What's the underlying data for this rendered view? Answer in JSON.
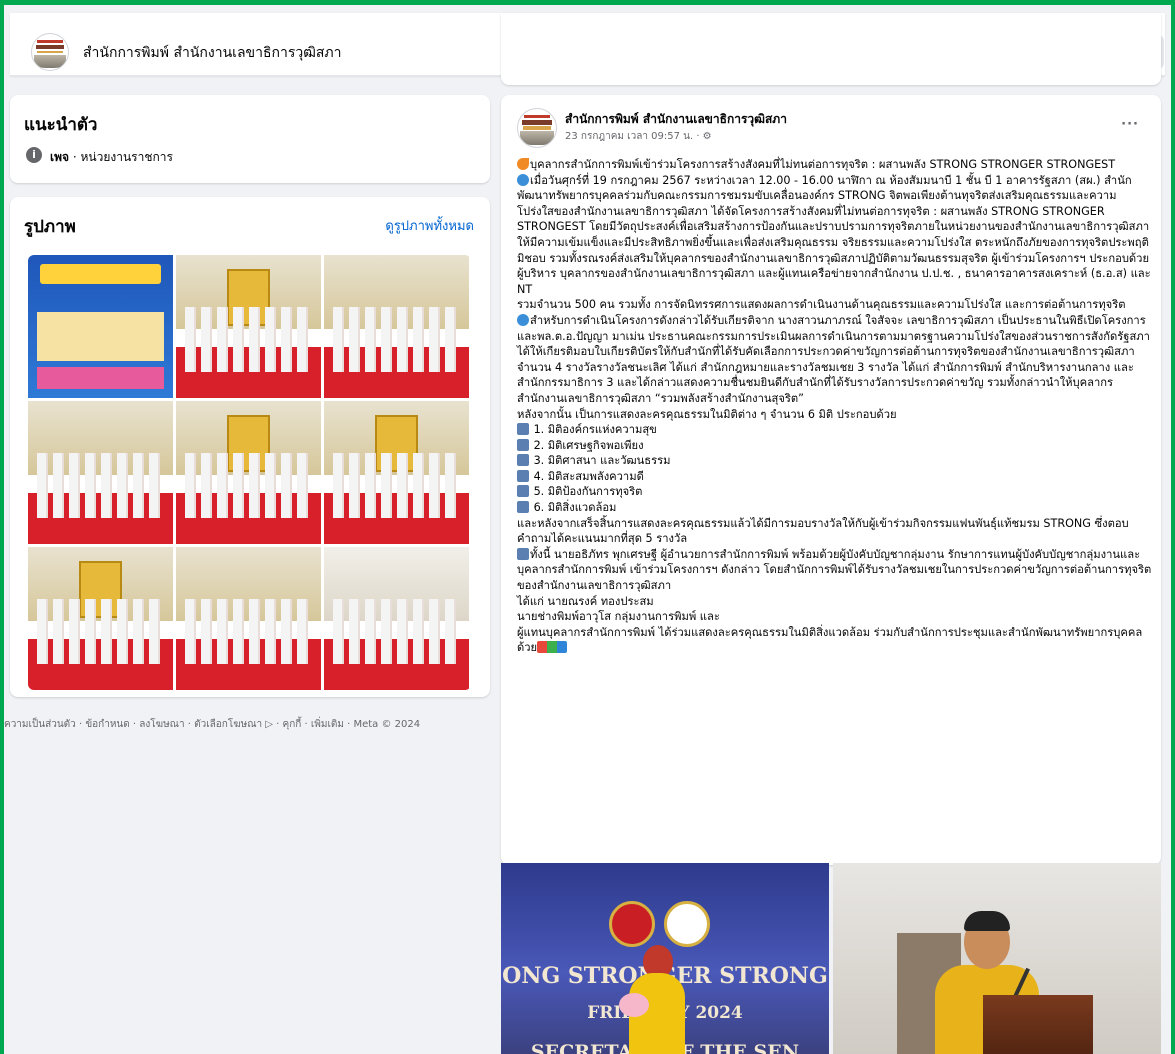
{
  "header": {
    "page_name": "สำนักการพิมพ์ สำนักงานเลขาธิการวุฒิสภา",
    "more_label": "···"
  },
  "intro": {
    "title": "แนะนำตัว",
    "type_bold": "เพจ",
    "type_rest": " · หน่วยงานราชการ"
  },
  "photos": {
    "title": "รูปภาพ",
    "see_all": "ดูรูปภาพทั้งหมด"
  },
  "footer": {
    "text": "ความเป็นส่วนตัว · ข้อกำหนด · ลงโฆษณา · ตัวเลือกโฆษณา ▷ · คุกกี้ · เพิ่มเติม · Meta © 2024"
  },
  "post": {
    "author": "สำนักการพิมพ์ สำนักงานเลขาธิการวุฒิสภา",
    "meta": "23 กรกฎาคม เวลา 09:57 น. · ⚙",
    "more_label": "···",
    "lines": [
      "บุคลากรสำนักการพิมพ์เข้าร่วมโครงการสร้างสังคมที่ไม่ทนต่อการทุจริต : ผสานพลัง STRONG STRONGER STRONGEST",
      "เมื่อวันศุกร์ที่ 19 กรกฎาคม 2567 ระหว่างเวลา 12.00 - 16.00 นาฬิกา ณ ห้องสัมมนาบี 1 ชั้น บี 1 อาคารรัฐสภา (สผ.) สำนักพัฒนาทรัพยากรบุคคลร่วมกับคณะกรรมการชมรมขับเคลื่อนองค์กร STRONG จิตพอเพียงต้านทุจริตส่งเสริมคุณธรรมและความโปร่งใสของสำนักงานเลขาธิการวุฒิสภา ได้จัดโครงการสร้างสังคมที่ไม่ทนต่อการทุจริต : ผสานพลัง STRONG STRONGER STRONGEST โดยมีวัตถุประสงค์เพื่อเสริมสร้างการป้องกันและปราบปรามการทุจริตภายในหน่วยงานของสำนักงานเลขาธิการวุฒิสภาให้มีความเข้มแข็งและมีประสิทธิภาพยิ่งขึ้นและเพื่อส่งเสริมคุณธรรม จริยธรรมและความโปร่งใส ตระหนักถึงภัยของการทุจริตประพฤติมิชอบ รวมทั้งรณรงค์ส่งเสริมให้บุคลากรของสำนักงานเลขาธิการวุฒิสภาปฏิบัติตามวัฒนธรรมสุจริต ผู้เข้าร่วมโครงการฯ ประกอบด้วย ผู้บริหาร บุคลากรของสำนักงานเลขาธิการวุฒิสภา และผู้แทนเครือข่ายจากสำนักงาน ป.ป.ช. , ธนาคารอาคารสงเคราะห์ (ธ.อ.ส) และ NT",
      "รวมจำนวน 500 คน รวมทั้ง การจัดนิทรรศการแสดงผลการดำเนินงานด้านคุณธรรมและความโปร่งใส และการต่อต้านการทุจริต",
      "สำหรับการดำเนินโครงการดังกล่าวได้รับเกียรติจาก นางสาวนภาภรณ์  ใจสัจจะ เลขาธิการวุฒิสภา เป็นประธานในพิธีเปิดโครงการ และพล.ต.อ.ปัญญา  มาเม่น ประธานคณะกรรมการประเมินผลการดำเนินการตามมาตรฐานความโปร่งใสของส่วนราชการสังกัดรัฐสภา ได้ให้เกียรติมอบใบเกียรติบัตรให้กับสำนักที่ได้รับคัดเลือกการประกวดค่าขวัญการต่อต้านการทุจริตของสำนักงานเลขาธิการวุฒิสภา จำนวน 4 รางวัลรางวัลชนะเลิศ ได้แก่ สำนักกฎหมายและรางวัลชมเชย 3 รางวัล ได้แก่  สำนักการพิมพ์ สำนักบริหารงานกลาง และสำนักกรรมาธิการ 3 และได้กล่าวแสดงความชื่นชมยินดีกับสำนักที่ได้รับรางวัลการประกวดค่าขวัญ รวมทั้งกล่าวนำให้บุคลากรสำนักงานเลขาธิการวุฒิสภา “รวมพลังสร้างสำนักงานสุจริต”",
      "หลังจากนั้น เป็นการแสดงละครคุณธรรมในมิติต่าง ๆ จำนวน 6 มิติ ประกอบด้วย"
    ],
    "list": [
      "1. มิติองค์กรแห่งความสุข",
      "2. มิติเศรษฐกิจพอเพียง",
      "3. มิติศาสนา และวัฒนธรรม",
      "4. มิติสะสมพลังความดี",
      "5. มิติป้องกันการทุจริต",
      "6. มิติสิ่งแวดล้อม"
    ],
    "after_list": [
      "และหลังจากเสร็จสิ้นการแสดงละครคุณธรรมแล้วได้มีการมอบรางวัลให้กับผู้เข้าร่วมกิจกรรมแฟนพันธุ์แท้ชมรม STRONG ซึ่งตอบคำถามได้คะแนนมากที่สุด 5 รางวัล",
      "ทั้งนี้ นายอธิภัทร พุกเศรษฐี ผู้อำนวยการสำนักการพิมพ์ พร้อมด้วยผู้บังคับบัญชากลุ่มงาน รักษาการแทนผู้บังคับบัญชากลุ่มงานและบุคลากรสำนักการพิมพ์ เข้าร่วมโครงการฯ ดังกล่าว โดยสำนักการพิมพ์ได้รับรางวัลชมเชยในการประกวดค่าขวัญการต่อต้านการทุจริตของสำนักงานเลขาธิการวุฒิสภา",
      "ได้แก่ นายณรงค์ ทองประสม",
      "นายช่างพิมพ์อาวุโส กลุ่มงานการพิมพ์ และ",
      "ผู้แทนบุคลากรสำนักการพิมพ์ ได้ร่วมแสดงละครคุณธรรมในมิติสิ่งแวดล้อม ร่วมกับสำนักการประชุมและสำนักพัฒนาทรัพยากรบุคคลด้วย"
    ]
  },
  "post_images": {
    "left_line1": "ONG STRONGER STRONG",
    "left_line2": "FRIDAY       LY 2024",
    "left_line3": "SECRETARI     OF THE SEN",
    "seal_text": "SENATE STRONG"
  },
  "colors": {
    "border": "#00a94f",
    "background": "#f0f2f5",
    "link": "#0064d1"
  }
}
